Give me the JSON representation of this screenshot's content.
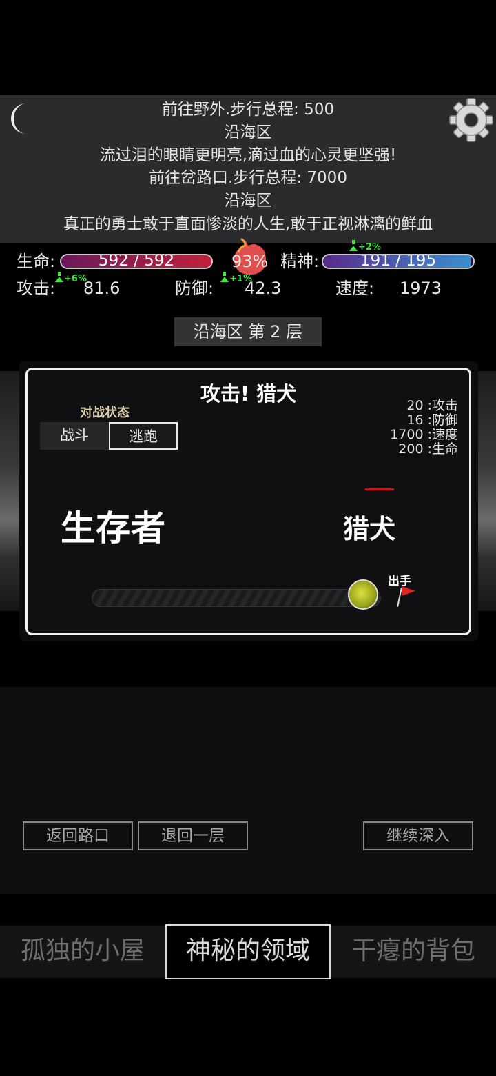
{
  "log": {
    "lines": [
      "前往野外.步行总程: 500",
      "沿海区",
      "流过泪的眼睛更明亮,滴过血的心灵更坚强!",
      "前往岔路口.步行总程: 7000",
      "沿海区",
      "真正的勇士敢于直面惨淡的人生,敢于正视淋漓的鲜血"
    ],
    "moon_icon": "crescent-moon-icon",
    "settings_icon": "gear-icon"
  },
  "stats": {
    "hp_label": "生命:",
    "hp_text": "592 / 592",
    "hp_fraction": 1.0,
    "satiety_percent": "93%",
    "spirit_label": "精神:",
    "spirit_text": "191 / 195",
    "spirit_fraction": 0.98,
    "spirit_bonus": "+2%",
    "attack_label": "攻击:",
    "attack_value": "81.6",
    "attack_bonus": "+6%",
    "defense_label": "防御:",
    "defense_value": "42.3",
    "defense_bonus": "+1%",
    "speed_label": "速度:",
    "speed_value": "1973",
    "colors": {
      "hp": "#c0213a",
      "spirit": "#3a8fd0",
      "bonus": "#3ee83e"
    }
  },
  "floor_label": "沿海区 第 2 层",
  "battle": {
    "title": "攻击! 猎犬",
    "status_label": "对战状态",
    "fight_button": "战斗",
    "flee_button": "逃跑",
    "enemy_stats": [
      "20 :攻击",
      "16 :防御",
      "1700 :速度",
      "200 :生命"
    ],
    "player_name": "生存者",
    "enemy_name": "猎犬",
    "action_label": "出手"
  },
  "nav": {
    "back_to_crossroad": "返回路口",
    "back_one_layer": "退回一层",
    "go_deeper": "继续深入"
  },
  "tabs": [
    "孤独的小屋",
    "神秘的领域",
    "干瘪的背包"
  ]
}
